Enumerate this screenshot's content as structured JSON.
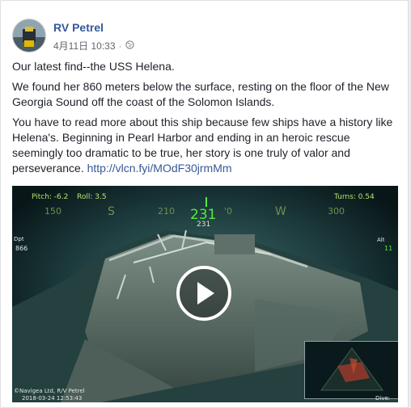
{
  "post": {
    "page_name": "RV Petrel",
    "timestamp": "4月11日 10:33",
    "audience_icon": "globe-icon",
    "paragraphs": [
      "Our latest find--the USS Helena.",
      "We found her 860 meters below the surface, resting on the floor of the New Georgia Sound off the coast of the Solomon Islands.",
      "You have to read more about this ship because few ships have a history like Helena's. Beginning in Pearl Harbor and ending in an heroic rescue seemingly too dramatic to be true, her story is one truly of valor and perseverance. "
    ],
    "link": "http://vlcn.fyi/MOdF30jrmMm"
  },
  "video": {
    "pitch": "Pitch: -6.2",
    "roll": "Roll: 3.5",
    "turns": "Turns: 0.54",
    "compass": [
      "150",
      "S",
      "210",
      "'0",
      "W",
      "300"
    ],
    "heading": "231",
    "heading_small": "231",
    "dpt_label": "Dpt",
    "dpt_value": "866",
    "alt_label": "Alt",
    "alt_value": "11",
    "watermark_line1": "©Navigea Ltd, R/V Petrel",
    "watermark_line2": "2018-03-24 12:53:43",
    "dive": "Dive: 83",
    "play_icon": "play-icon"
  }
}
